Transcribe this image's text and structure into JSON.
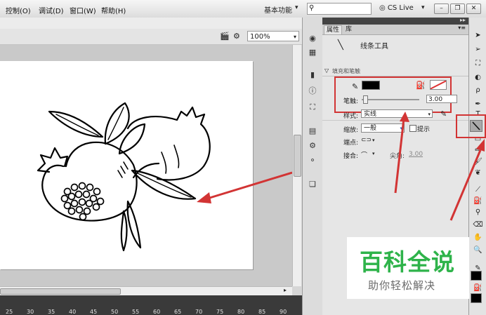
{
  "menubar": {
    "items": [
      "控制(O)",
      "调试(D)",
      "窗口(W)",
      "帮助(H)"
    ],
    "workspace": "基本功能",
    "cs_live": "CS Live"
  },
  "edit_bar": {
    "zoom": "100%"
  },
  "ruler": {
    "ticks": [
      "25",
      "30",
      "35",
      "40",
      "45",
      "50",
      "55",
      "60",
      "65",
      "70",
      "75",
      "80",
      "85",
      "90"
    ]
  },
  "panel": {
    "tabs": [
      "属性",
      "库"
    ],
    "tool_name": "线条工具",
    "section_label": "填充和笔触",
    "stroke_label": "笔触:",
    "stroke_value": "3.00",
    "style_label": "样式:",
    "style_value": "实线",
    "scale_label": "缩放:",
    "scale_value": "一般",
    "hint_label": "提示",
    "cap_label": "端点:",
    "join_label": "接合:",
    "miter_label": "尖角:",
    "miter_value": "3.00"
  },
  "colors": {
    "highlight_red": "#d23434",
    "watermark_green": "#2eb34a"
  },
  "icons": {
    "side_panel": [
      "color-wheel-icon",
      "grid-icon",
      "align-icon",
      "info-icon",
      "transform-icon",
      "history-icon",
      "components-icon",
      "motion-icon",
      "pages-icon"
    ],
    "toolbar": [
      "selection-tool-icon",
      "subselection-tool-icon",
      "free-transform-icon",
      "3d-rotation-icon",
      "lasso-icon",
      "pen-icon",
      "text-tool-icon",
      "line-tool-icon",
      "rectangle-tool-icon",
      "pencil-tool-icon",
      "brush-tool-icon",
      "deco-tool-icon",
      "bone-tool-icon",
      "paint-bucket-icon",
      "eyedropper-icon",
      "eraser-icon",
      "hand-tool-icon",
      "zoom-tool-icon",
      "stroke-color-icon",
      "fill-color-icon"
    ]
  },
  "watermark": {
    "title": "百科全说",
    "subtitle": "助你轻松解决"
  }
}
